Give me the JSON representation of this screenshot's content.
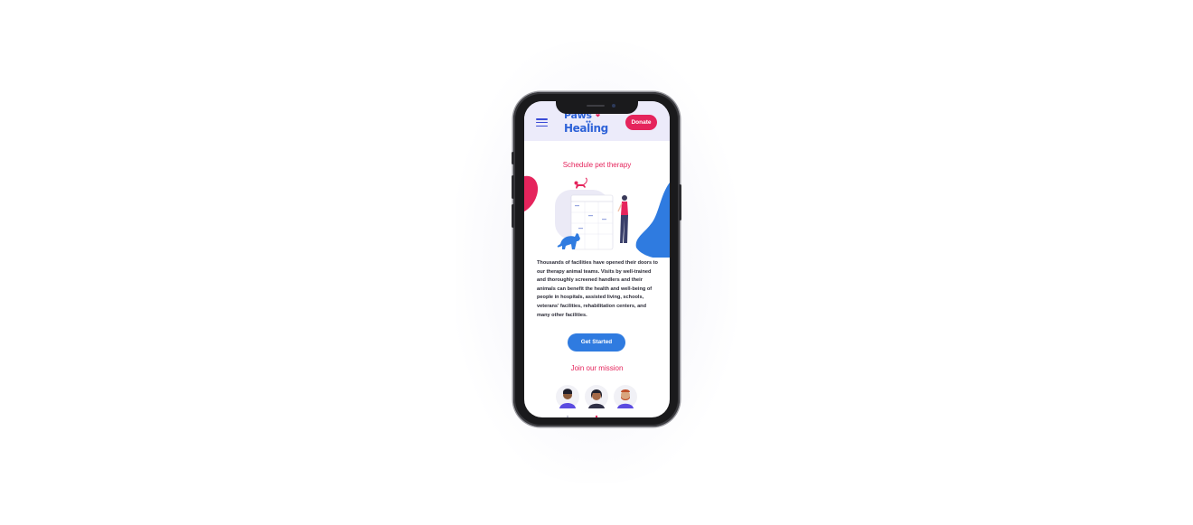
{
  "header": {
    "logo_line1": "Paws",
    "logo_line2": "Healing",
    "donate_label": "Donate"
  },
  "schedule": {
    "title": "Schedule pet therapy",
    "body": "Thousands of facilities have opened their doors to our therapy animal teams. Visits by well-trained and thoroughly screened handlers and their animals can benefit the health and well-being of people in hospitals, assisted living, schools, veterans' facilities, rehabilitation centers, and many other facilities.",
    "cta_label": "Get Started"
  },
  "mission": {
    "title": "Join our mission"
  },
  "colors": {
    "brand_blue": "#2f63d8",
    "accent_pink": "#e5245c",
    "button_blue": "#2f7be0",
    "header_bg": "#ecebfa"
  },
  "icons": [
    "hamburger-menu-icon",
    "heart-icon",
    "paw-icon",
    "cat-icon",
    "dog-icon",
    "calendar-icon"
  ]
}
